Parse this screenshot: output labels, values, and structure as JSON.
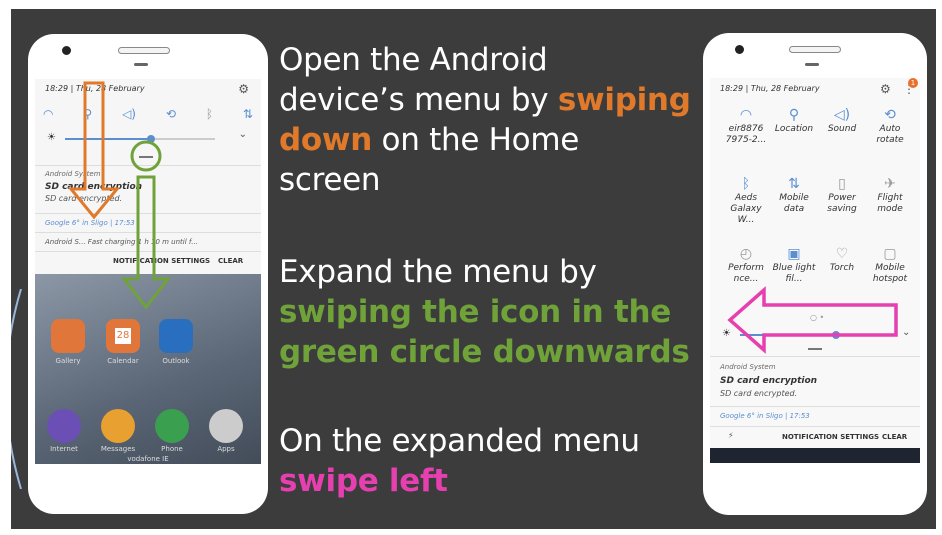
{
  "captions": {
    "step1_a": "Open the Android\ndevice’s menu by ",
    "step1_hl1": "swiping\ndown",
    "step1_b": " on the Home\nscreen",
    "step2_a": "Expand the menu by\n",
    "step2_hl": "swiping the icon in the\ngreen circle downwards",
    "step3_a": "On the expanded menu\n",
    "step3_hl": "swipe left"
  },
  "colors": {
    "orange": "#e07a2a",
    "green": "#70a23a",
    "pink": "#e63faf",
    "background": "#3c3c3c"
  },
  "left_phone": {
    "status_time": "18:29 | Thu, 28 February",
    "notif_source": "Android System",
    "notif_title": "SD card encryption",
    "notif_text": "SD card encrypted.",
    "google_line": "Google  6° in Sligo  |  17:53",
    "charging_line": "Android S...  Fast charging  1 h 10 m until f...",
    "notif_settings": "NOTIFICATION SETTINGS",
    "clear": "CLEAR",
    "carrier": "vodafone IE",
    "calendar_day": "28",
    "dock": [
      "Internet",
      "Messages",
      "Phone",
      "Apps"
    ],
    "apps_row": [
      "Gallery",
      "Calendar",
      "Outlook"
    ]
  },
  "right_phone": {
    "status_time": "18:29 | Thu, 28 February",
    "badge": "1",
    "tiles_row1": [
      "eir8876\n7975-2...",
      "Location",
      "Sound",
      "Auto\nrotate"
    ],
    "tiles_row2": [
      "Aeds\nGalaxy W...",
      "Mobile\ndata",
      "Power\nsaving",
      "Flight\nmode"
    ],
    "tiles_row3": [
      "Perform\nnce...",
      "Blue light\nfil...",
      "Torch",
      "Mobile\nhotspot"
    ],
    "notif_source": "Android System",
    "notif_title": "SD card encryption",
    "notif_text": "SD card encrypted.",
    "google_line": "Google  6° in Sligo  |  17:53",
    "notif_settings": "NOTIFICATION SETTINGS",
    "clear": "CLEAR"
  }
}
